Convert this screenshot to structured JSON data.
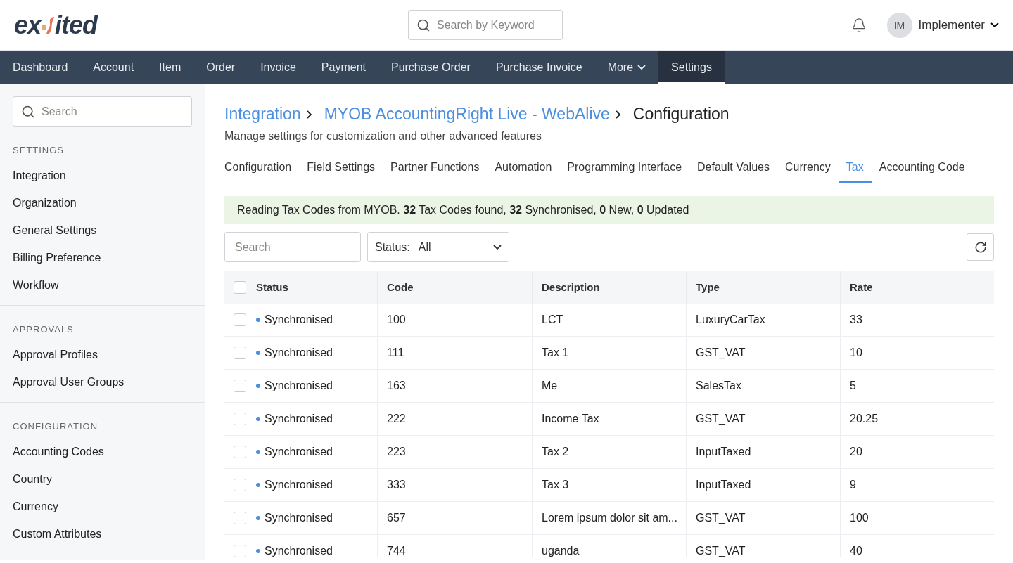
{
  "logo": {
    "left": "ex",
    "right": "ited"
  },
  "header_search": {
    "placeholder": "Search by Keyword"
  },
  "user": {
    "initials": "IM",
    "name": "Implementer"
  },
  "nav": [
    {
      "label": "Dashboard",
      "selected": false,
      "kind": "link"
    },
    {
      "label": "Account",
      "selected": false,
      "kind": "link"
    },
    {
      "label": "Item",
      "selected": false,
      "kind": "link"
    },
    {
      "label": "Order",
      "selected": false,
      "kind": "link"
    },
    {
      "label": "Invoice",
      "selected": false,
      "kind": "link"
    },
    {
      "label": "Payment",
      "selected": false,
      "kind": "link"
    },
    {
      "label": "Purchase Order",
      "selected": false,
      "kind": "link"
    },
    {
      "label": "Purchase Invoice",
      "selected": false,
      "kind": "link"
    },
    {
      "label": "More",
      "selected": false,
      "kind": "dropdown"
    },
    {
      "label": "Settings",
      "selected": true,
      "kind": "link"
    }
  ],
  "sidebar": {
    "search": {
      "placeholder": "Search"
    },
    "sections": [
      {
        "title": "SETTINGS",
        "items": [
          "Integration",
          "Organization",
          "General Settings",
          "Billing Preference",
          "Workflow"
        ]
      },
      {
        "title": "APPROVALS",
        "items": [
          "Approval Profiles",
          "Approval User Groups"
        ]
      },
      {
        "title": "CONFIGURATION",
        "items": [
          "Accounting Codes",
          "Country",
          "Currency",
          "Custom Attributes"
        ]
      }
    ]
  },
  "breadcrumb": [
    {
      "label": "Integration",
      "kind": "link"
    },
    {
      "label": "MYOB AccountingRight Live - WebAlive",
      "kind": "link"
    },
    {
      "label": "Configuration",
      "kind": "current"
    }
  ],
  "subtitle": "Manage settings for customization and other advanced features",
  "tabs": [
    {
      "label": "Configuration",
      "selected": false
    },
    {
      "label": "Field Settings",
      "selected": false
    },
    {
      "label": "Partner Functions",
      "selected": false
    },
    {
      "label": "Automation",
      "selected": false
    },
    {
      "label": "Programming Interface",
      "selected": false
    },
    {
      "label": "Default Values",
      "selected": false
    },
    {
      "label": "Currency",
      "selected": false
    },
    {
      "label": "Tax",
      "selected": true
    },
    {
      "label": "Accounting Code",
      "selected": false
    }
  ],
  "banner": "Reading Tax Codes from MYOB. **32** Tax Codes found, **32** Synchronised, **0** New, **0** Updated",
  "filter_search": {
    "placeholder": "Search"
  },
  "status_filter": {
    "label": "Status:",
    "value": "All"
  },
  "table": {
    "columns": [
      "Status",
      "Code",
      "Description",
      "Type",
      "Rate"
    ],
    "all_checked": false,
    "rows": [
      {
        "checked": false,
        "status": "Synchronised",
        "color": "#4a90e2",
        "code": "100",
        "description": "LCT",
        "type": "LuxuryCarTax",
        "rate": "33"
      },
      {
        "checked": false,
        "status": "Synchronised",
        "color": "#4a90e2",
        "code": "111",
        "description": "Tax 1",
        "type": "GST_VAT",
        "rate": "10"
      },
      {
        "checked": false,
        "status": "Synchronised",
        "color": "#4a90e2",
        "code": "163",
        "description": "Me",
        "type": "SalesTax",
        "rate": "5"
      },
      {
        "checked": false,
        "status": "Synchronised",
        "color": "#4a90e2",
        "code": "222",
        "description": "Income Tax",
        "type": "GST_VAT",
        "rate": "20.25"
      },
      {
        "checked": false,
        "status": "Synchronised",
        "color": "#4a90e2",
        "code": "223",
        "description": "Tax 2",
        "type": "InputTaxed",
        "rate": "20"
      },
      {
        "checked": false,
        "status": "Synchronised",
        "color": "#4a90e2",
        "code": "333",
        "description": "Tax 3",
        "type": "InputTaxed",
        "rate": "9"
      },
      {
        "checked": false,
        "status": "Synchronised",
        "color": "#4a90e2",
        "code": "657",
        "description": "Lorem ipsum dolor sit am...",
        "type": "GST_VAT",
        "rate": "100"
      },
      {
        "checked": false,
        "status": "Synchronised",
        "color": "#4a90e2",
        "code": "744",
        "description": "uganda",
        "type": "GST_VAT",
        "rate": "40"
      }
    ]
  }
}
